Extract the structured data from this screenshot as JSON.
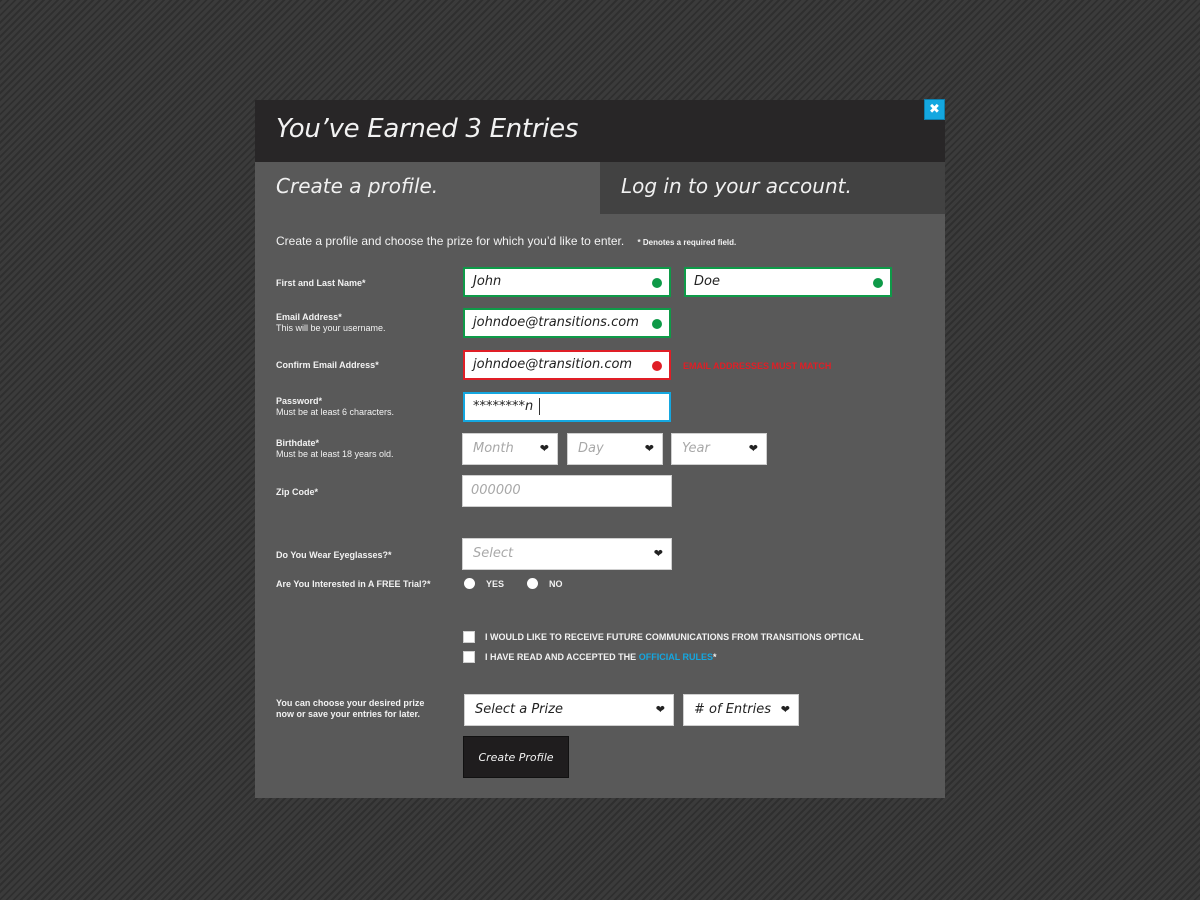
{
  "modal": {
    "title": "You’ve Earned 3 Entries",
    "close_glyph": "✖"
  },
  "tabs": {
    "create": "Create a profile.",
    "login": "Log in to your account."
  },
  "intro": {
    "text": "Create a profile and choose the prize for which you’d like to enter.",
    "required_note": "* Denotes a required field."
  },
  "labels": {
    "name": "First and Last Name*",
    "email": "Email Address*",
    "email_hint": "This will be your username.",
    "confirm_email": "Confirm Email Address*",
    "password": "Password*",
    "password_hint": "Must be at least 6 characters.",
    "birthdate": "Birthdate*",
    "birthdate_hint": "Must be at least 18 years old.",
    "zip": "Zip Code*",
    "eyeglasses": "Do You Wear Eyeglasses?*",
    "trial": "Are You Interested in A FREE Trial?*",
    "prize_line1": "You can choose your desired prize",
    "prize_line2": "now or save your entries for later."
  },
  "fields": {
    "first_name": "John",
    "last_name": "Doe",
    "email": "johndoe@transitions.com",
    "confirm_email": "johndoe@transition.com",
    "password": "********n",
    "zip_placeholder": "000000"
  },
  "errors": {
    "email_mismatch": "EMAIL ADDRESSES MUST MATCH"
  },
  "selects": {
    "month": "Month",
    "day": "Day",
    "year": "Year",
    "eyeglasses": "Select",
    "prize": "Select a Prize",
    "entries": "# of Entries",
    "chevron_glyph": "❤"
  },
  "radios": {
    "yes": "YES",
    "no": "NO"
  },
  "checkboxes": {
    "communications": "I WOULD LIKE TO RECEIVE FUTURE COMMUNICATIONS FROM TRANSITIONS OPTICAL",
    "rules_prefix": "I HAVE READ AND ACCEPTED THE",
    "rules_link": "OFFICIAL RULES",
    "rules_suffix": "*"
  },
  "button": {
    "create": "Create Profile"
  },
  "colors": {
    "accent": "#14a7e0",
    "valid": "#0e9a48",
    "error": "#e01e26",
    "header": "#282627",
    "panel": "#595959"
  }
}
